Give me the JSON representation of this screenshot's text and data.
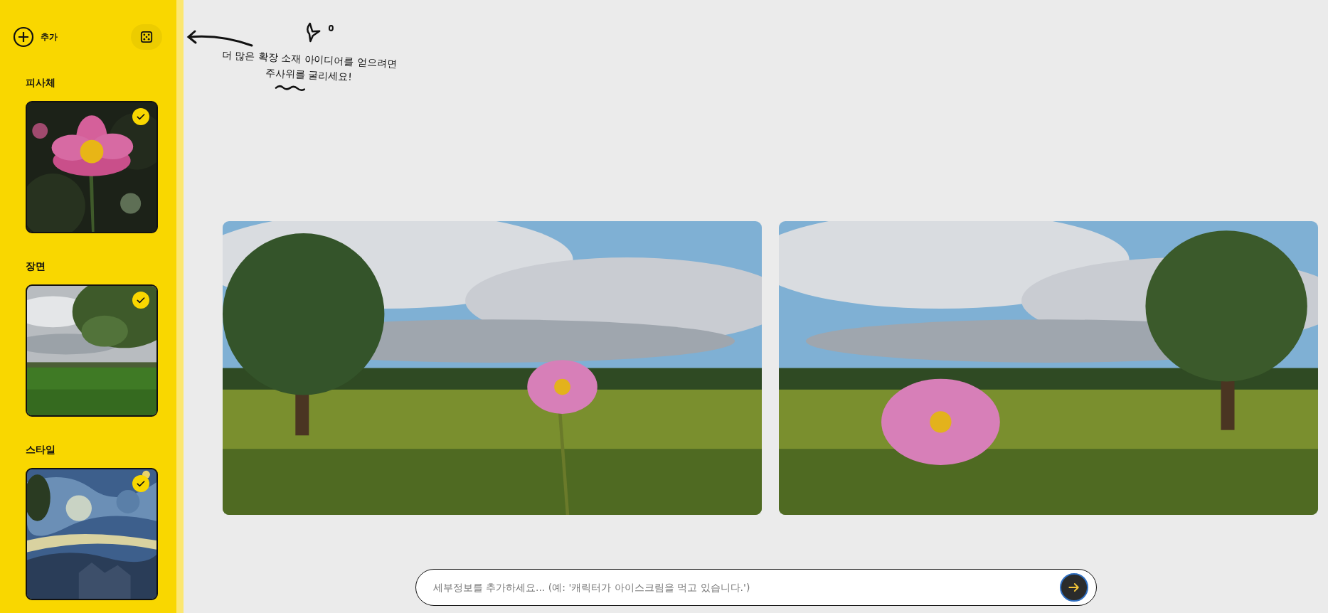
{
  "sidebar": {
    "add_button": {
      "label": "추가"
    },
    "sections": [
      {
        "title": "피사체",
        "selected": true
      },
      {
        "title": "장면",
        "selected": true
      },
      {
        "title": "스타일",
        "selected": true
      }
    ]
  },
  "hint": {
    "text": "더 많은 확장 소재 아이디어를 얻으려면 주사위를 굴리세요!"
  },
  "prompt": {
    "placeholder": "세부정보를 추가하세요... (예: '캐릭터가 아이스크림을 먹고 있습니다.')"
  }
}
